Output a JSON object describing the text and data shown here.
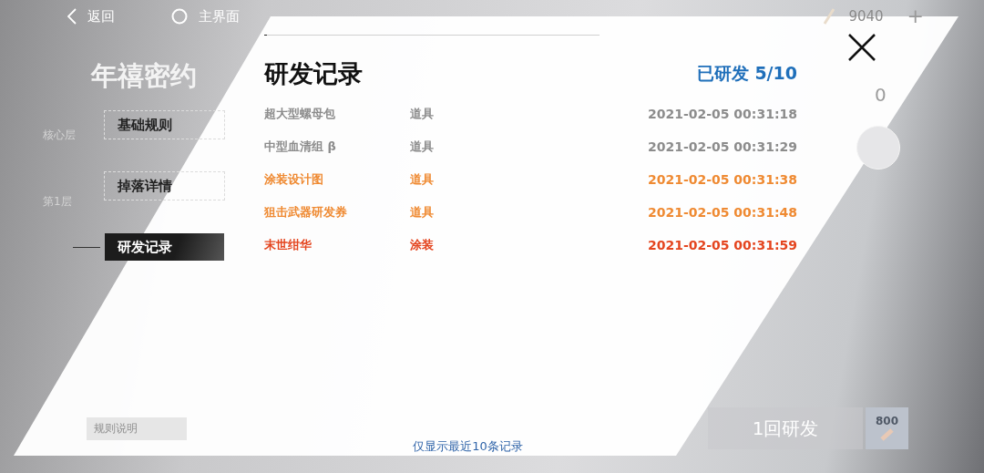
{
  "top_bar": {
    "back": "返回",
    "home": "主界面",
    "currency": "9040",
    "add": "+"
  },
  "event_title": "年禧密约",
  "layers": [
    "核心层",
    "第1层"
  ],
  "tabs": [
    {
      "label": "基础规则",
      "selected": false
    },
    {
      "label": "掉落详情",
      "selected": false
    },
    {
      "label": "研发记录",
      "selected": true
    }
  ],
  "dialog": {
    "title": "研发记录",
    "progress": "已研发 5/10",
    "records": [
      {
        "name": "超大型螺母包",
        "type": "道具",
        "time": "2021-02-05 00:31:18",
        "color": "#8c8c8c"
      },
      {
        "name": "中型血清组 β",
        "type": "道具",
        "time": "2021-02-05 00:31:29",
        "color": "#8c8c8c"
      },
      {
        "name": "涂装设计图",
        "type": "道具",
        "time": "2021-02-05 00:31:38",
        "color": "#ef8a32"
      },
      {
        "name": "狙击武器研发券",
        "type": "道具",
        "time": "2021-02-05 00:31:48",
        "color": "#ef8a32"
      },
      {
        "name": "末世绀华",
        "type": "涂装",
        "time": "2021-02-05 00:31:59",
        "color": "#e4451f"
      }
    ],
    "note": "仅显示最近10条记录"
  },
  "side_count": "0",
  "rules_button": "规则说明",
  "develop_button": "1回研发",
  "cost": "800"
}
